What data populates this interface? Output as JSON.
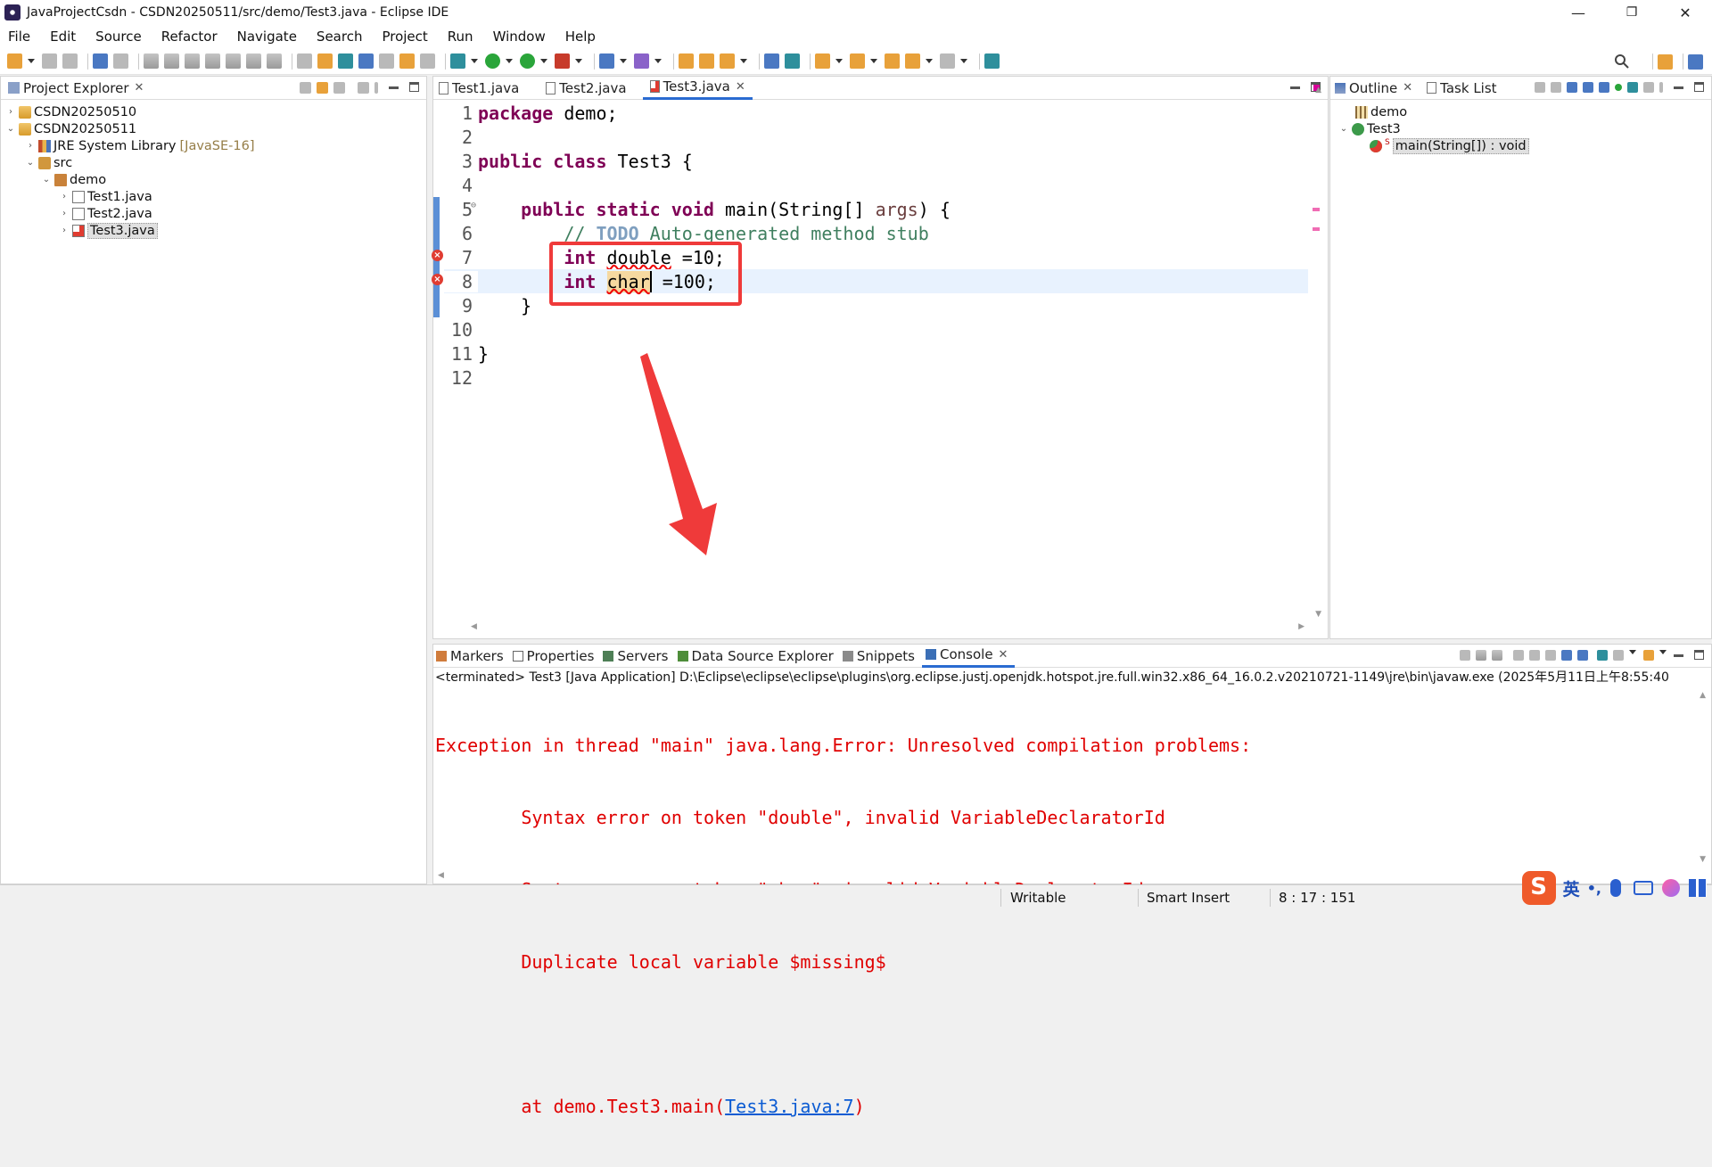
{
  "window": {
    "title": "JavaProjectCsdn - CSDN20250511/src/demo/Test3.java - Eclipse IDE",
    "controls": {
      "minimize": "—",
      "restore": "❐",
      "close": "✕"
    }
  },
  "menu": [
    "File",
    "Edit",
    "Source",
    "Refactor",
    "Navigate",
    "Search",
    "Project",
    "Run",
    "Window",
    "Help"
  ],
  "project_explorer": {
    "tab_label": "Project Explorer",
    "tree": [
      {
        "label": "CSDN20250510",
        "twisty": "›"
      },
      {
        "label": "CSDN20250511",
        "twisty": "⌄"
      },
      {
        "label": "JRE System Library",
        "suffix": "[JavaSE-16]",
        "twisty": "›"
      },
      {
        "label": "src",
        "twisty": "⌄"
      },
      {
        "label": "demo",
        "twisty": "⌄"
      },
      {
        "label": "Test1.java",
        "twisty": "›"
      },
      {
        "label": "Test2.java",
        "twisty": "›"
      },
      {
        "label": "Test3.java",
        "twisty": "›"
      }
    ]
  },
  "editor": {
    "tabs": [
      {
        "label": "Test1.java"
      },
      {
        "label": "Test2.java"
      },
      {
        "label": "Test3.java",
        "close": "✕"
      }
    ],
    "line_numbers": [
      "1",
      "2",
      "3",
      "4",
      "5",
      "6",
      "7",
      "8",
      "9",
      "10",
      "11",
      "12"
    ],
    "lines": {
      "l1_kw": "package",
      "l1_rest": " demo;",
      "l3_kw1": "public",
      "l3_kw2": "class",
      "l3_rest": " Test3 {",
      "l5_kw1": "public",
      "l5_kw2": "static",
      "l5_kw3": "void",
      "l5_rest": " main(String[] ",
      "l5_args": "args",
      "l5_end": ") {",
      "l6_slashes": "// ",
      "l6_todo": "TODO",
      "l6_rest": " Auto-generated method stub",
      "l7_kw": "int",
      "l7_err": "double",
      "l7_rest": " =10;",
      "l8_kw": "int",
      "l8_err": "char",
      "l8_rest": " =100;",
      "l9": "}",
      "l11": "}"
    },
    "fold_marker": "⊖",
    "error_glyph": "×"
  },
  "outline": {
    "tabs": [
      {
        "label": "Outline"
      },
      {
        "label": "Task List"
      }
    ],
    "items": [
      {
        "label": "demo"
      },
      {
        "label": "Test3",
        "twisty": "⌄"
      },
      {
        "label": "main(String[]) : void",
        "superscript": "S"
      }
    ]
  },
  "bottom_tabs": [
    {
      "label": "Markers"
    },
    {
      "label": "Properties"
    },
    {
      "label": "Servers"
    },
    {
      "label": "Data Source Explorer"
    },
    {
      "label": "Snippets"
    },
    {
      "label": "Console",
      "close": "✕"
    }
  ],
  "console": {
    "path": "<terminated> Test3 [Java Application] D:\\Eclipse\\eclipse\\eclipse\\plugins\\org.eclipse.justj.openjdk.hotspot.jre.full.win32.x86_64_16.0.2.v20210721-1149\\jre\\bin\\javaw.exe  (2025年5月11日上午8:55:40",
    "line1": "Exception in thread \"main\" java.lang.Error: Unresolved compilation problems: ",
    "line2": "\tSyntax error on token \"double\", invalid VariableDeclaratorId",
    "line3": "\tSyntax error on token \"char\", invalid VariableDeclaratorId",
    "line4": "\tDuplicate local variable $missing$",
    "line6_prefix": "\tat demo.Test3.main(",
    "line6_link": "Test3.java:7",
    "line6_suffix": ")"
  },
  "status": {
    "writable": "Writable",
    "insert_mode": "Smart Insert",
    "position": "8 : 17 : 151"
  },
  "ime": {
    "lang": "英",
    "punct": "•,"
  },
  "colors": {
    "keyword": "#7f0055",
    "comment": "#3f7f5f",
    "error_text": "#e00000",
    "annotation_box": "#ef3a3a",
    "link": "#0b5bd3",
    "active_tab": "#2a6bd1"
  },
  "icons": [
    "app-icon",
    "new-icon",
    "save-icon",
    "run-icon",
    "debug-icon",
    "search-icon",
    "java-file-icon",
    "package-icon",
    "folder-icon",
    "library-icon",
    "project-icon",
    "error-marker-icon",
    "method-icon",
    "class-icon",
    "outline-icon",
    "task-icon",
    "console-icon",
    "markers-icon",
    "properties-icon",
    "servers-icon",
    "snippets-icon",
    "sogou-ime-icon",
    "microphone-icon",
    "keyboard-icon"
  ]
}
